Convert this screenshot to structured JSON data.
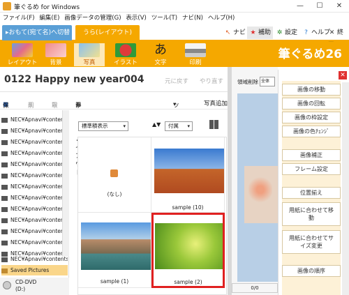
{
  "window": {
    "title": "筆ぐるめ for Windows",
    "minimize": "—",
    "maximize": "☐",
    "close": "✕"
  },
  "menu": [
    "ファイル(F)",
    "編集(E)",
    "画像データの管理(G)",
    "表示(V)",
    "ツール(T)",
    "ナビ(N)",
    "ヘルプ(H)"
  ],
  "tabs": {
    "front": "▸おもて(宛て名)へ切替",
    "back": "うら(レイアウト)"
  },
  "topbar": {
    "navi": "ナビ",
    "hojo": "補助",
    "settings": "設定",
    "help": "ヘルプ",
    "exit": "終了"
  },
  "toolbar": {
    "items": [
      {
        "label": "レイアウト"
      },
      {
        "label": "背景"
      },
      {
        "label": "写真"
      },
      {
        "label": "イラスト"
      },
      {
        "label": "文字"
      },
      {
        "label": "印刷"
      }
    ],
    "logo": "筆ぐるめ26"
  },
  "doc": {
    "title": "0122  Happy new year004",
    "undo": "元に戻す",
    "redo": "やり直す"
  },
  "filetool": {
    "save": "保存",
    "delete": "削除",
    "import": "取込",
    "easy_layout": "かんたんレイアウト",
    "tools": "ツール",
    "add_photo": "写真追加"
  },
  "tree": {
    "items": [
      "NEC¥Apnavi¥contents¥...",
      "NEC¥Apnavi¥contents¥...",
      "NEC¥Apnavi¥contents¥...",
      "NEC¥Apnavi¥contents¥...",
      "NEC¥Apnavi¥contents¥...",
      "NEC¥Apnavi¥contents¥...",
      "NEC¥Apnavi¥contents¥...",
      "NEC¥Apnavi¥contents¥...",
      "NEC¥Apnavi¥contents¥...",
      "NEC¥Apnavi¥contents¥...",
      "NEC¥Apnavi¥contents¥...",
      "NEC¥Apnavi¥contents¥...",
      "NEC¥Apnavi¥contents¥...",
      "NEC¥Apnavi¥contents¥...",
      "Saved Pictures"
    ],
    "drive": "CD-DVD",
    "drive_letter": "(D:)"
  },
  "thumbs": {
    "display_mode": "標準積表示",
    "sort": "付属",
    "items": [
      {
        "caption": "(なし)"
      },
      {
        "caption": "sample (10)"
      },
      {
        "caption": "sample (1)"
      },
      {
        "caption": "sample (2)"
      }
    ]
  },
  "preview": {
    "label": "領域削除",
    "zoom": "全体",
    "counter": "0/0"
  },
  "panel": {
    "buttons": [
      "画像の移動",
      "画像の回転",
      "画像の枠設定",
      "画像の色ﾁｪﾝｼﾞ",
      "画像補正",
      "フレーム設定",
      "位置揃え",
      "用紙に合わせて移動",
      "用紙に合わせてサイズ変更",
      "画像の順序"
    ]
  },
  "colors": {
    "accent": "#f5a800",
    "tab_front": "#5a9fd6",
    "selection": "#e02020"
  }
}
